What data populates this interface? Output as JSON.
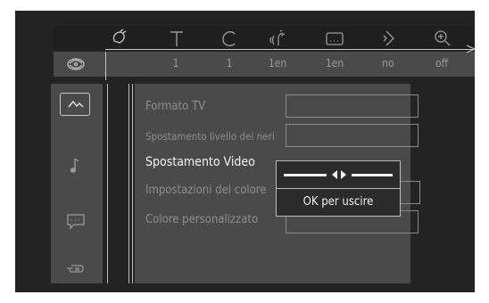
{
  "top_bar": {
    "icons": [
      "angle-icon",
      "subtitle-text-icon",
      "chapter-icon",
      "audio-language-icon",
      "subtitle-box-icon",
      "play-mode-icon",
      "zoom-icon"
    ],
    "values": [
      "1",
      "1",
      "1en",
      "1en",
      "no",
      "off"
    ]
  },
  "sidebar": {
    "items": [
      {
        "icon": "picture-settings-icon",
        "active": true
      },
      {
        "icon": "music-note-icon",
        "active": false
      },
      {
        "icon": "subtitle-speech-icon",
        "active": false
      },
      {
        "icon": "hand-pointer-icon",
        "active": false
      }
    ]
  },
  "menu": {
    "items": [
      {
        "label": "Formato TV",
        "active": false
      },
      {
        "label": "Spostamento livello dei neri",
        "active": false
      },
      {
        "label": "Spostamento Video",
        "active": true
      },
      {
        "label": "Impostazioni del colore",
        "active": false
      },
      {
        "label": "Colore personalizzato",
        "active": false
      }
    ]
  },
  "popup": {
    "hint": "OK per uscire"
  },
  "colors": {
    "background": "#232323",
    "panel": "#4a4a4a",
    "text_dim": "#8e8e8e",
    "text_active": "#f2f2f2"
  }
}
